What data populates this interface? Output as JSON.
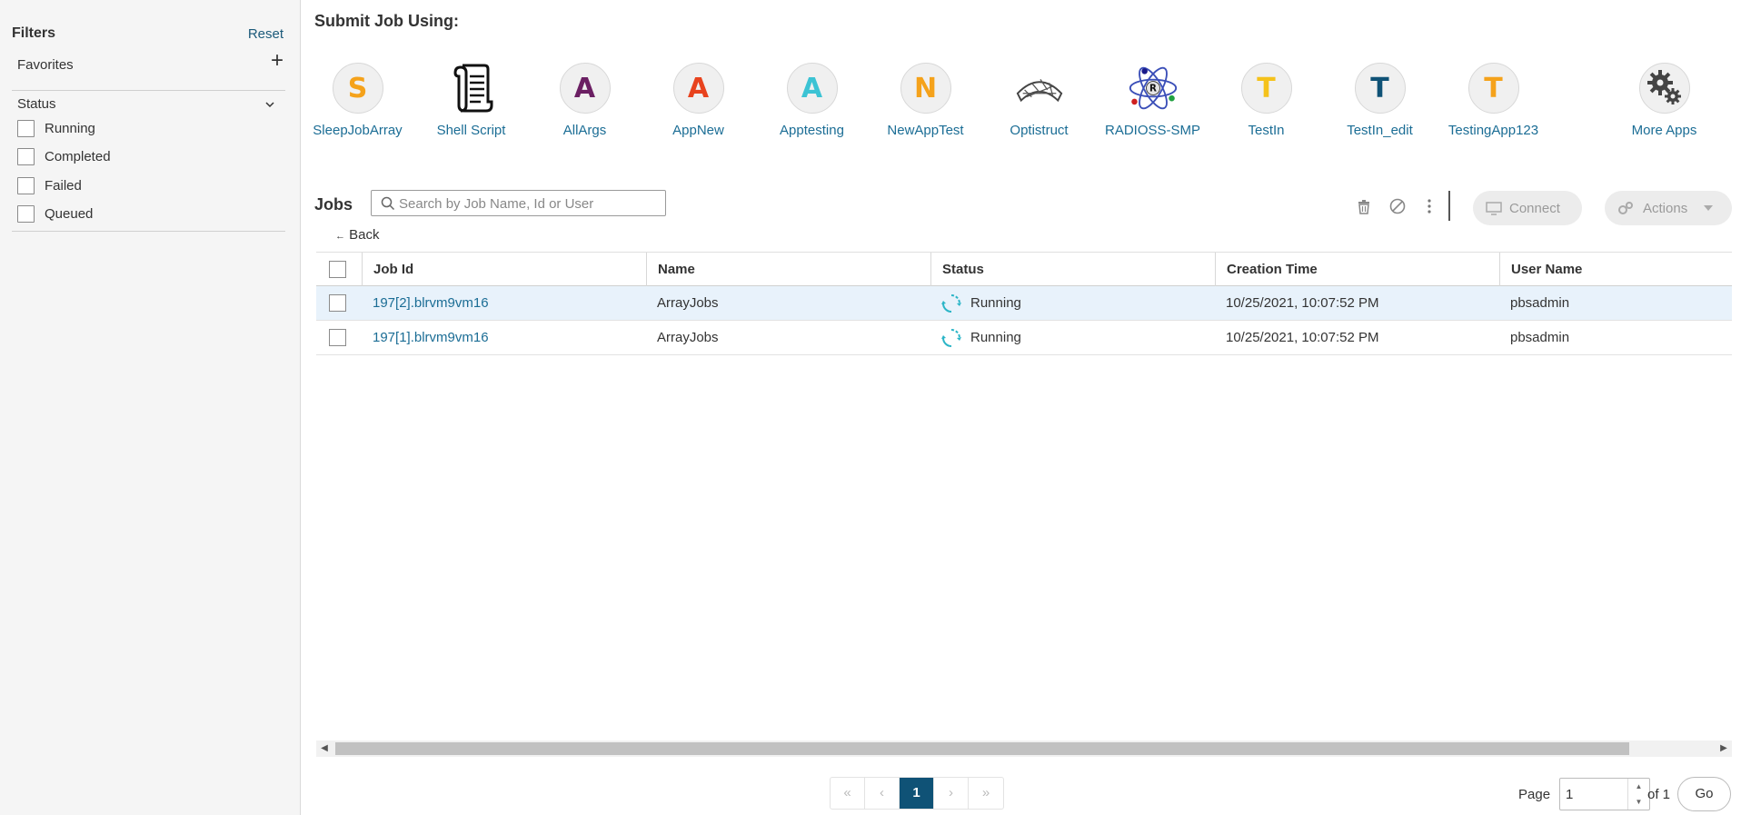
{
  "sidebar": {
    "title": "Filters",
    "reset_label": "Reset",
    "favorites_label": "Favorites",
    "favorites_add": "+",
    "status_label": "Status",
    "status_options": [
      {
        "label": "Running",
        "checked": false
      },
      {
        "label": "Completed",
        "checked": false
      },
      {
        "label": "Failed",
        "checked": false
      },
      {
        "label": "Queued",
        "checked": false
      }
    ]
  },
  "submit": {
    "title": "Submit Job Using:",
    "apps": [
      {
        "label": "SleepJobArray",
        "letter": "S",
        "color": "#f5a21b",
        "icon": "letter"
      },
      {
        "label": "Shell Script",
        "letter": "",
        "color": "#222222",
        "icon": "scroll-icon"
      },
      {
        "label": "AllArgs",
        "letter": "A",
        "color": "#6b1f63",
        "icon": "letter"
      },
      {
        "label": "AppNew",
        "letter": "A",
        "color": "#e8431e",
        "icon": "letter"
      },
      {
        "label": "Apptesting",
        "letter": "A",
        "color": "#3cc3d4",
        "icon": "letter"
      },
      {
        "label": "NewAppTest",
        "letter": "N",
        "color": "#f5a21b",
        "icon": "letter"
      },
      {
        "label": "Optistruct",
        "letter": "",
        "color": "#555555",
        "icon": "mesh-icon"
      },
      {
        "label": "RADIOSS-SMP",
        "letter": "",
        "color": "#3b4fb8",
        "icon": "atom-icon"
      },
      {
        "label": "TestIn",
        "letter": "T",
        "color": "#f5c21b",
        "icon": "letter"
      },
      {
        "label": "TestIn_edit",
        "letter": "T",
        "color": "#0f5276",
        "icon": "letter"
      },
      {
        "label": "TestingApp123",
        "letter": "T",
        "color": "#f5a21b",
        "icon": "letter"
      },
      {
        "label": "More Apps",
        "letter": "",
        "color": "#555555",
        "icon": "gears-icon"
      }
    ]
  },
  "jobs": {
    "title": "Jobs",
    "search_placeholder": "Search by Job Name, Id or User",
    "connect_label": "Connect",
    "actions_label": "Actions",
    "back_label": "Back",
    "columns": [
      "Job Id",
      "Name",
      "Status",
      "Creation Time",
      "User Name"
    ],
    "rows": [
      {
        "id": "197[2].blrvm9vm16",
        "name": "ArrayJobs",
        "status": "Running",
        "created": "10/25/2021, 10:07:52 PM",
        "user": "pbsadmin",
        "selected": true
      },
      {
        "id": "197[1].blrvm9vm16",
        "name": "ArrayJobs",
        "status": "Running",
        "created": "10/25/2021, 10:07:52 PM",
        "user": "pbsadmin",
        "selected": false
      }
    ]
  },
  "pagination": {
    "first": "«",
    "prev": "‹",
    "current": "1",
    "next": "›",
    "last": "»",
    "page_label": "Page",
    "page_value": "1",
    "of_label": "of 1",
    "go_label": "Go"
  },
  "colors": {
    "accent": "#0f5276",
    "link": "#1b6d95",
    "spinner": "#2bb5c7",
    "selected_row": "#e8f2fb"
  }
}
